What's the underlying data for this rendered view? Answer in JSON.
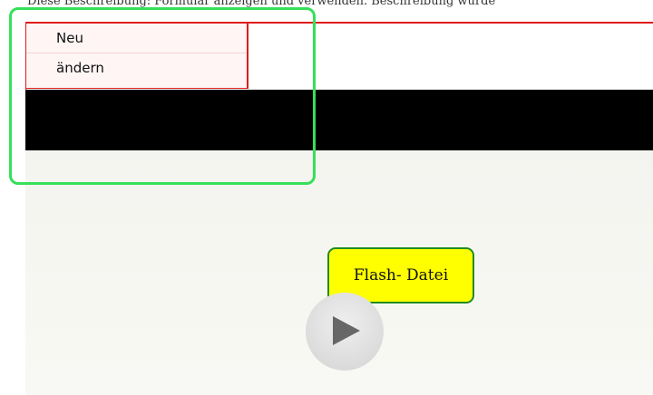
{
  "header": {
    "top_text": "Diese Beschreibung: Formular anzeigen und verwenden. Beschreibung wurde"
  },
  "menu": {
    "items": [
      {
        "label": "Neu"
      },
      {
        "label": "ändern"
      }
    ]
  },
  "callout": {
    "label": "Flash- Datei"
  },
  "colors": {
    "frame_red": "#e01b1b",
    "highlight_green": "#36e05a",
    "callout_yellow": "#ffff00",
    "callout_border": "#228b22"
  },
  "icons": {
    "play": "play-icon"
  }
}
